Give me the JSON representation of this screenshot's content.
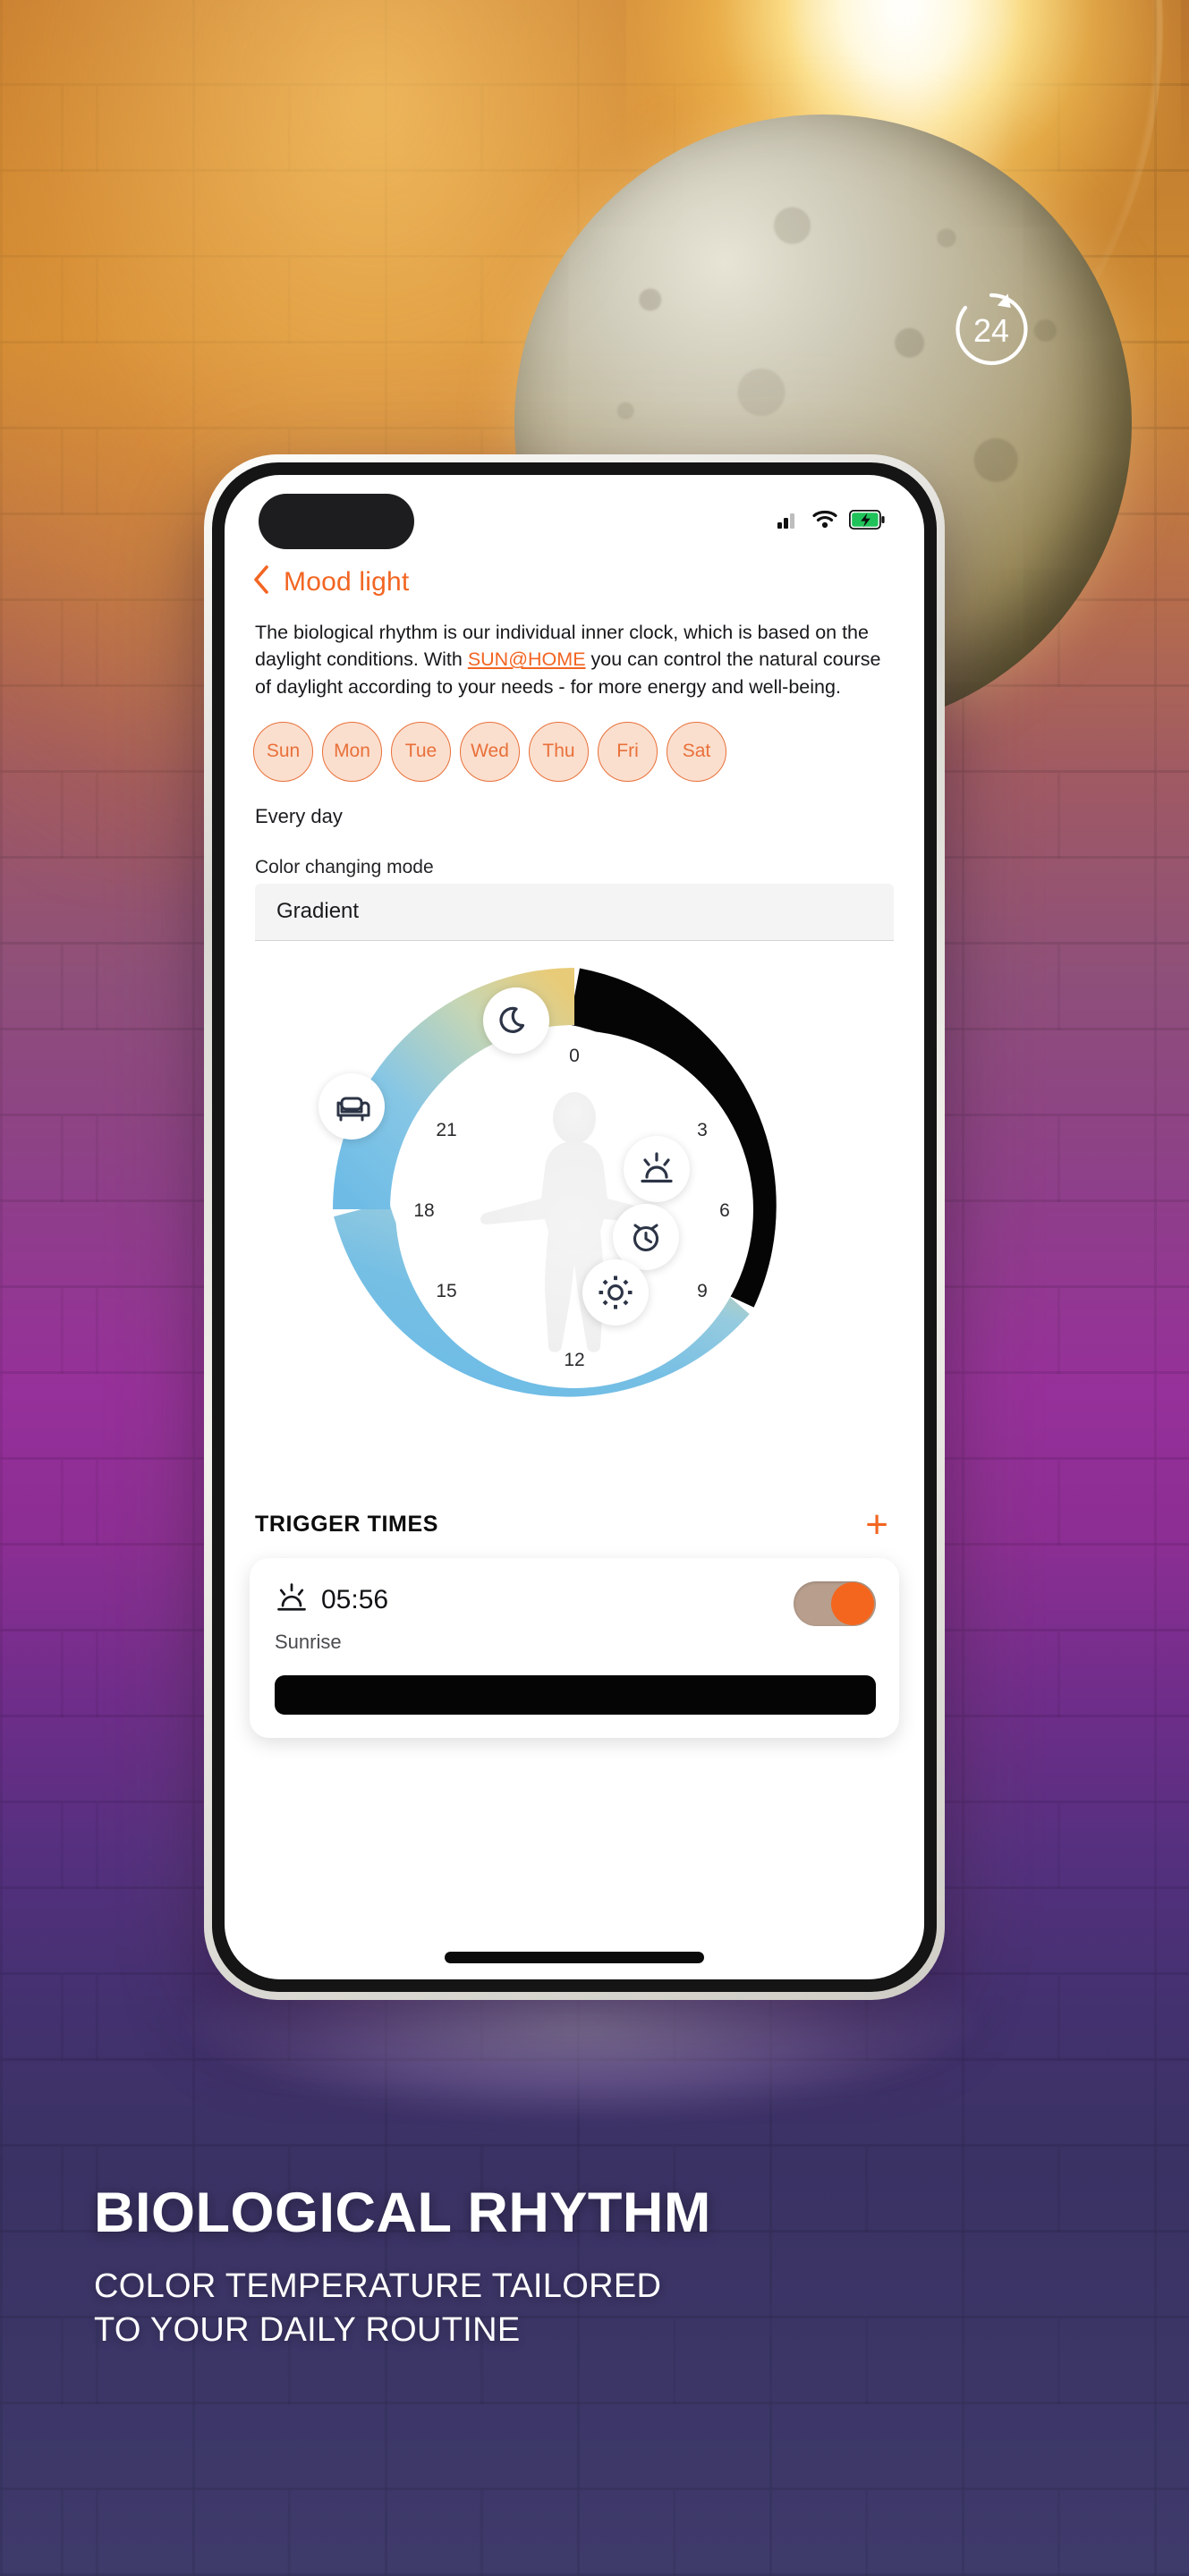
{
  "background": {
    "badge_24": "24",
    "badge_name": "24-hour-cycle-badge"
  },
  "phone": {
    "status_bar": {
      "signal_icon": "cellular-signal-icon",
      "wifi_icon": "wifi-icon",
      "battery_icon": "battery-charging-icon"
    },
    "nav": {
      "back_icon": "back-chevron-icon",
      "title": "Mood light"
    },
    "intro": {
      "part1": "The biological rhythm is our individual inner clock, which is based on the daylight conditions. With ",
      "link": "SUN@HOME",
      "part2": " you can control the natural course of daylight according to your needs - for more energy and well-being."
    },
    "days": [
      {
        "label": "Sun",
        "selected": true
      },
      {
        "label": "Mon",
        "selected": true
      },
      {
        "label": "Tue",
        "selected": true
      },
      {
        "label": "Wed",
        "selected": true
      },
      {
        "label": "Thu",
        "selected": true
      },
      {
        "label": "Fri",
        "selected": true
      },
      {
        "label": "Sat",
        "selected": true
      }
    ],
    "repeat_summary": "Every day",
    "color_mode": {
      "label": "Color changing mode",
      "value": "Gradient"
    },
    "dial": {
      "hours": [
        "0",
        "3",
        "6",
        "9",
        "12",
        "15",
        "18",
        "21"
      ],
      "icons": [
        {
          "name": "moon-icon",
          "hour": 23
        },
        {
          "name": "sunrise-icon",
          "hour": 6.2
        },
        {
          "name": "alarm-clock-icon",
          "hour": 7.6
        },
        {
          "name": "sun-brightness-icon",
          "hour": 9.1
        },
        {
          "name": "armchair-icon",
          "hour": 20
        }
      ],
      "body_silhouette": "human-body-silhouette"
    },
    "trigger_times": {
      "title": "TRIGGER TIMES",
      "add_icon": "plus-icon",
      "items": [
        {
          "icon": "sunrise-icon",
          "time": "05:56",
          "label": "Sunrise",
          "enabled": true,
          "color_swatch": "#050506"
        }
      ]
    }
  },
  "headline": {
    "title": "BIOLOGICAL RHYTHM",
    "sub_line1": "COLOR TEMPERATURE TAILORED",
    "sub_line2": "TO YOUR DAILY ROUTINE"
  },
  "colors": {
    "accent_orange": "#F26522",
    "chip_border": "#E8703A",
    "chip_fill": "#FBDFCE",
    "toggle_on": "#F4661E",
    "toggle_track": "#B79E8D"
  }
}
